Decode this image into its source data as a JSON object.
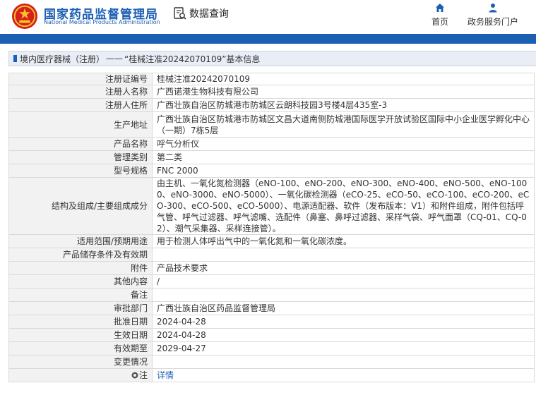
{
  "header": {
    "brand_cn": "国家药品监督管理局",
    "brand_en": "National Medical Products Administration",
    "search_label": "数据查询",
    "nav_home": "首页",
    "nav_service": "政务服务门户"
  },
  "breadcrumb": {
    "section": "境内医疗器械（注册）",
    "separator": "——",
    "detail": "“桂械注准20242070109”基本信息"
  },
  "rows": [
    {
      "label": "注册证编号",
      "value": "桂械注准20242070109"
    },
    {
      "label": "注册人名称",
      "value": "广西诺港生物科技有限公司"
    },
    {
      "label": "注册人住所",
      "value": "广西壮族自治区防城港市防城区云朗科技园3号楼4层435室-3"
    },
    {
      "label": "生产地址",
      "value": "广西壮族自治区防城港市防城区文昌大道南侧防城港国际医学开放试验区国际中小企业医学孵化中心（一期）7栋5层"
    },
    {
      "label": "产品名称",
      "value": "呼气分析仪"
    },
    {
      "label": "管理类别",
      "value": "第二类"
    },
    {
      "label": "型号规格",
      "value": "FNC 2000"
    },
    {
      "label": "结构及组成/主要组成成分",
      "value": "由主机、一氧化氮检测器（eNO-100、eNO-200、eNO-300、eNO-400、eNO-500、eNO-1000、eNO-3000、eNO-5000）、一氧化碳检测器（eCO-25、eCO-50、eCO-100、eCO-200、eCO-300、eCO-500、eCO-5000）、电源适配器、软件（发布版本：V1）和附件组成，附件包括呼气管、呼气过滤器、呼气滤嘴、选配件（鼻塞、鼻呼过滤器、采样气袋、呼气面罩（CQ-01、CQ-02）、潮气采集器、采样连接管）。"
    },
    {
      "label": "适用范围/预期用途",
      "value": "用于检测人体呼出气中的一氧化氮和一氧化碳浓度。"
    },
    {
      "label": "产品储存条件及有效期",
      "value": ""
    },
    {
      "label": "附件",
      "value": "产品技术要求"
    },
    {
      "label": "其他内容",
      "value": "/"
    },
    {
      "label": "备注",
      "value": ""
    },
    {
      "label": "审批部门",
      "value": "广西壮族自治区药品监督管理局"
    },
    {
      "label": "批准日期",
      "value": "2024-04-28"
    },
    {
      "label": "生效日期",
      "value": "2024-04-28"
    },
    {
      "label": "有效期至",
      "value": "2029-04-27"
    },
    {
      "label": "变更情况",
      "value": ""
    }
  ],
  "note_row": {
    "label": "注",
    "value": "详情"
  }
}
